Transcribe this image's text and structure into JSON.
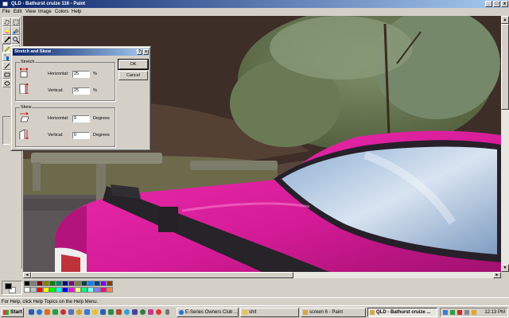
{
  "window": {
    "title": "QLD - Bathurst cruize 116 - Paint"
  },
  "menu": [
    "File",
    "Edit",
    "View",
    "Image",
    "Colors",
    "Help"
  ],
  "toolbox": {
    "tools": [
      "free-select-icon",
      "select-icon",
      "eraser-icon",
      "fill-icon",
      "color-picker-icon",
      "magnifier-icon",
      "pencil-icon",
      "brush-icon",
      "airbrush-icon",
      "text-icon",
      "line-icon",
      "curve-icon",
      "rectangle-icon",
      "polygon-icon",
      "ellipse-icon",
      "rounded-rectangle-icon"
    ],
    "selected_tool": "pencil-icon"
  },
  "dialog": {
    "title": "Stretch and Skew",
    "help_button": "?",
    "close_button": "x",
    "stretch": {
      "label": "Stretch",
      "horizontal_label": "Horizontal:",
      "horizontal_value": "25",
      "horizontal_unit": "%",
      "vertical_label": "Vertical:",
      "vertical_value": "25",
      "vertical_unit": "%"
    },
    "skew": {
      "label": "Skew",
      "horizontal_label": "Horizontal:",
      "horizontal_value": "0",
      "horizontal_unit": "Degrees",
      "vertical_label": "Vertical:",
      "vertical_value": "0",
      "vertical_unit": "Degrees"
    },
    "ok_label": "OK",
    "cancel_label": "Cancel"
  },
  "palette": {
    "primary": "#000000",
    "secondary": "#ffffff",
    "colors": [
      "#000000",
      "#808080",
      "#800000",
      "#808000",
      "#008000",
      "#008080",
      "#000080",
      "#800080",
      "#808040",
      "#004040",
      "#0080ff",
      "#004080",
      "#8000ff",
      "#804000",
      "#ffffff",
      "#c0c0c0",
      "#ff0000",
      "#ffff00",
      "#00ff00",
      "#00ffff",
      "#0000ff",
      "#ff00ff",
      "#ffff80",
      "#00ff80",
      "#80ffff",
      "#8080ff",
      "#ff0080",
      "#ff8040"
    ]
  },
  "status": {
    "text": "For Help, click Help Topics on the Help Menu."
  },
  "taskbar": {
    "start_label": "Start",
    "tasks": [
      {
        "label": "E-Series Owners Club ...",
        "active": false
      },
      {
        "label": "shit",
        "active": false
      },
      {
        "label": "screen 6 - Paint",
        "active": false
      },
      {
        "label": "QLD - Bathurst cruize ...",
        "active": true
      }
    ],
    "clock": "12:13 PM"
  }
}
